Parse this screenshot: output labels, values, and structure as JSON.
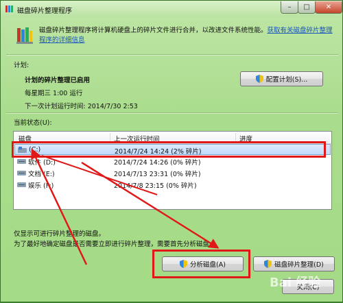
{
  "window": {
    "title": "磁盘碎片整理程序"
  },
  "description": {
    "text": "磁盘碎片整理程序将计算机硬盘上的碎片文件进行合并，以改进文件系统性能。",
    "link_line1": "获取有关磁盘碎片整理",
    "link_line2": "程序的详细信息"
  },
  "schedule": {
    "section_label": "计划:",
    "status": "计划的碎片整理已启用",
    "frequency": "每星期三 1:00 运行",
    "next_run": "下一次计划运行时间: 2014/7/30 2:53",
    "configure_button": "配置计划(S)..."
  },
  "current_status": {
    "label": "当前状态(U):",
    "columns": [
      "磁盘",
      "上一次运行时间",
      "进度"
    ],
    "rows": [
      {
        "disk": "(C:)",
        "last_run": "2014/7/24 14:24 (2% 碎片)",
        "progress": "",
        "selected": true
      },
      {
        "disk": "软件 (D:)",
        "last_run": "2014/7/24 14:26 (0% 碎片)",
        "progress": ""
      },
      {
        "disk": "文档 (E:)",
        "last_run": "2014/7/13 23:31 (0% 碎片)",
        "progress": ""
      },
      {
        "disk": "娱乐 (F:)",
        "last_run": "2014/7/8 23:15 (0% 碎片)",
        "progress": ""
      }
    ]
  },
  "notes": {
    "line1": "仅显示可进行碎片整理的磁盘。",
    "line2": "为了最好地确定磁盘是否需要立即进行碎片整理，需要首先分析磁盘。"
  },
  "buttons": {
    "analyze": "分析磁盘(A)",
    "defrag": "磁盘碎片整理(D)",
    "close": "关闭(C)"
  },
  "watermark": "Bai 经验",
  "colors": {
    "annotation_red": "#e01818",
    "window_green": "#a9dc8c",
    "link_blue": "#1a55b8"
  }
}
